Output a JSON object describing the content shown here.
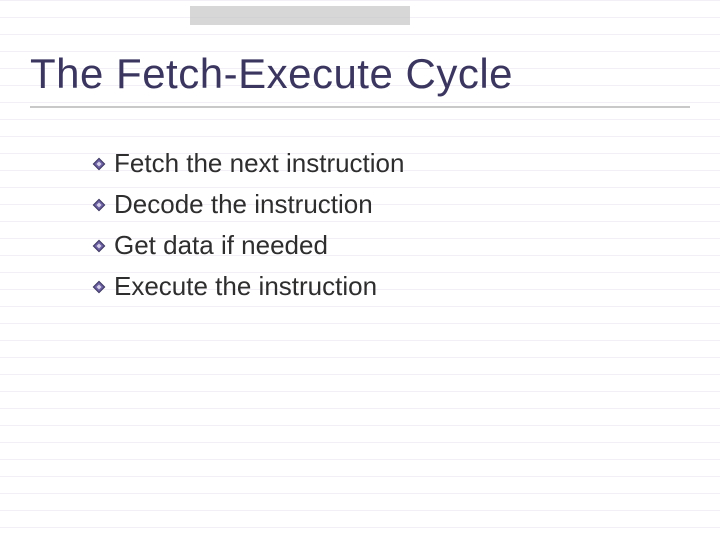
{
  "slide": {
    "title": "The Fetch-Execute Cycle",
    "bullets": [
      "Fetch the next instruction",
      "Decode the instruction",
      "Get data if needed",
      "Execute the instruction"
    ]
  },
  "colors": {
    "title": "#3a3660",
    "bullet_fill": "#6a5fa0",
    "bullet_border": "#3a3660"
  }
}
